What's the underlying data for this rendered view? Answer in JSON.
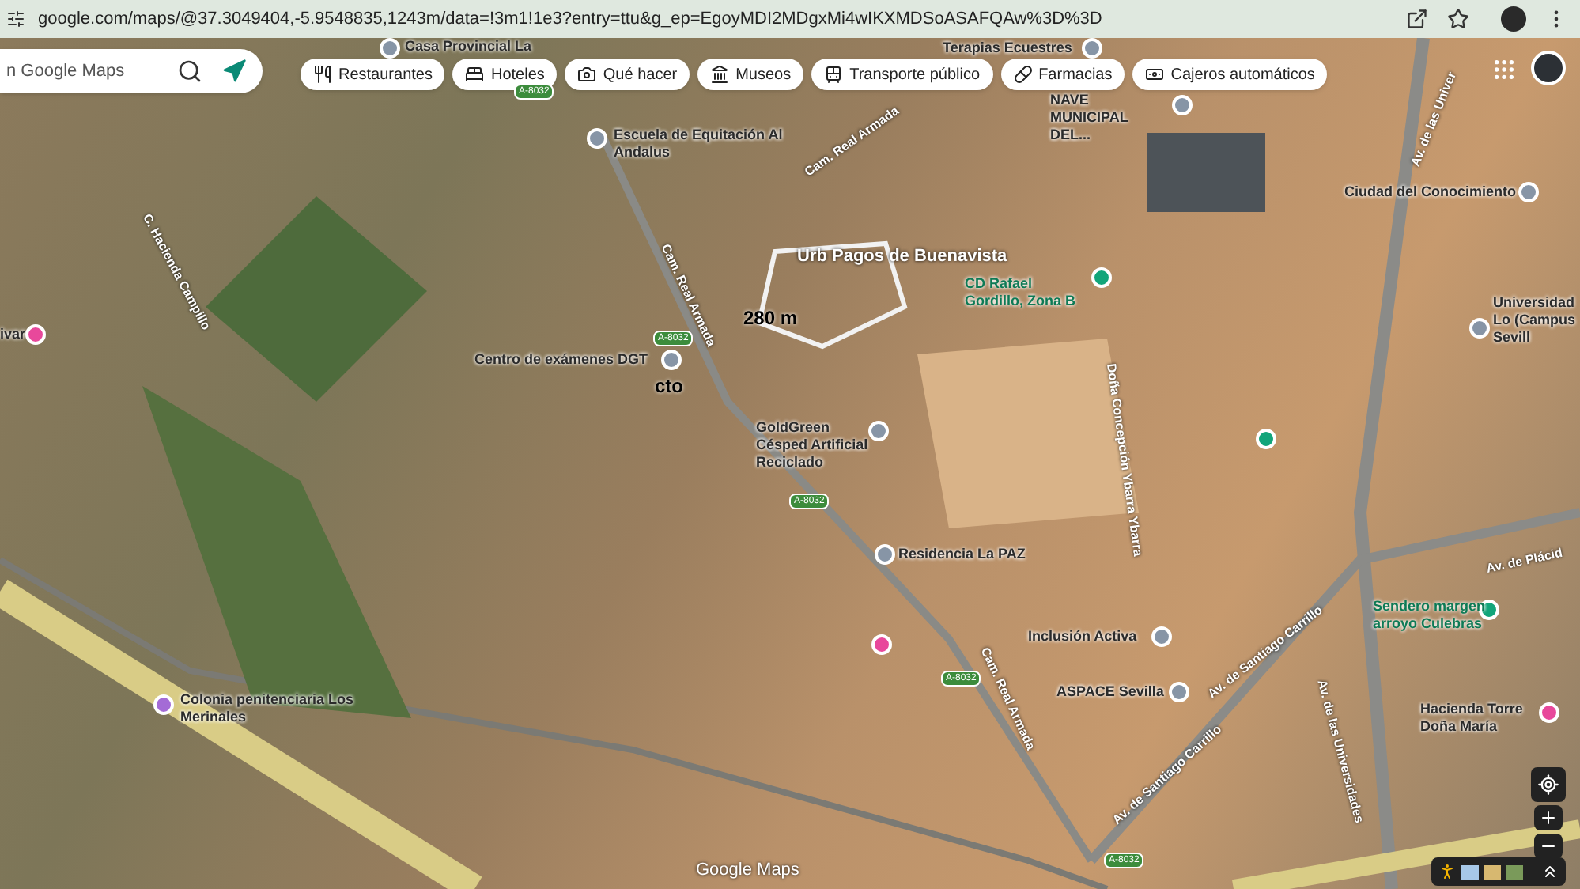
{
  "browser": {
    "url": "google.com/maps/@37.3049404,-5.9548835,1243m/data=!3m1!1e3?entry=ttu&g_ep=EgoyMDI2MDgxMi4wIKXMDSoASAFQAw%3D%3D"
  },
  "search": {
    "placeholder": "n Google Maps"
  },
  "chips": [
    {
      "label": "Restaurantes"
    },
    {
      "label": "Hoteles"
    },
    {
      "label": "Qué hacer"
    },
    {
      "label": "Museos"
    },
    {
      "label": "Transporte público"
    },
    {
      "label": "Farmacias"
    },
    {
      "label": "Cajeros automáticos"
    }
  ],
  "places": [
    {
      "name": "Casa Provincial La",
      "color": "#8795a6"
    },
    {
      "name": "Terapias Ecuestres",
      "color": "#8795a6"
    },
    {
      "name": "Escuela de Equitación Al Andalus",
      "color": "#8795a6"
    },
    {
      "name": "NAVE MUNICIPAL DEL...",
      "color": "#8795a6"
    },
    {
      "name": "Ciudad del Conocimiento",
      "color": "#8795a6"
    },
    {
      "name": "Universidad Lo (Campus Sevill",
      "color": "#8795a6"
    },
    {
      "name": "CD Rafael Gordillo, Zona B",
      "color": "#12a57a"
    },
    {
      "color": "#12a57a"
    },
    {
      "name": "Centro de exámenes DGT",
      "color": "#8795a6"
    },
    {
      "name": "GoldGreen Césped Artificial Reciclado",
      "color": "#8795a6"
    },
    {
      "name": "Residencia La PAZ",
      "color": "#8795a6"
    },
    {
      "color": "#e8489b"
    },
    {
      "name": "Inclusión Activa",
      "color": "#8795a6"
    },
    {
      "name": "ASPACE Sevilla",
      "color": "#8795a6"
    },
    {
      "name": "Sendero margen arroyo Culebras",
      "color": "#12a57a"
    },
    {
      "name": "Hacienda Torre Doña María",
      "color": "#e8489b"
    },
    {
      "name": "Colonia penitenciaria Los Merinales",
      "color": "#a46bd6"
    },
    {
      "name": "ivar",
      "color": "#e8489b"
    }
  ],
  "area_label": "Urb Pagos de Buenavista",
  "distance": "280 m",
  "marker_label": "cto",
  "streets": [
    "Av. de las Univer",
    "Av. de las Universidades",
    "Av. de Santiago Carrillo",
    "Av. de Santiago Carrillo",
    "Av. de Plácid",
    "Doña Concepción Ybarra Ybarra",
    "Cam. Real Armada",
    "Cam. Real Armada",
    "Cam. Real Armada",
    "C. Hacienda Campillo"
  ],
  "road_shields": [
    "A-8032",
    "A-8032",
    "A-8032",
    "A-8032",
    "A-8032"
  ],
  "attribution": "Google Maps"
}
